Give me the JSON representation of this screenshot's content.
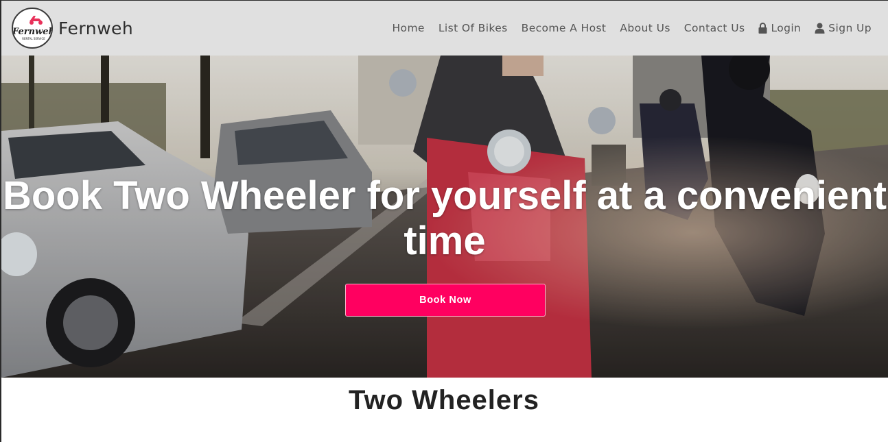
{
  "brand": {
    "name": "Fernweh",
    "logo_text": "Fernweh",
    "logo_subtext": "RENTAL SERVICE"
  },
  "nav": {
    "items": [
      {
        "label": "Home"
      },
      {
        "label": "List Of Bikes"
      },
      {
        "label": "Become A Host"
      },
      {
        "label": "About Us"
      },
      {
        "label": "Contact Us"
      },
      {
        "label": "Login",
        "icon": "lock-icon"
      },
      {
        "label": "Sign Up",
        "icon": "user-icon"
      }
    ]
  },
  "hero": {
    "title": "Book Two Wheeler for yourself at a convenient time",
    "button_label": "Book Now"
  },
  "section": {
    "title": "Two Wheelers"
  },
  "colors": {
    "navbar_bg": "#e0e0e0",
    "accent": "#ff0060",
    "scooter_red": "#d8344a"
  }
}
